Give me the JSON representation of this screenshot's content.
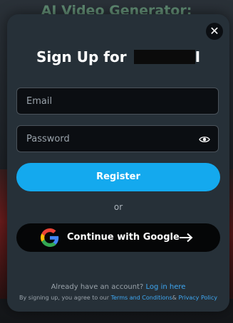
{
  "background": {
    "title": "AI Video Generator:"
  },
  "modal": {
    "close_symbol": "✕",
    "title_prefix": "Sign Up for",
    "title_suffix": "I",
    "email": {
      "placeholder": "Email",
      "value": ""
    },
    "password": {
      "placeholder": "Password",
      "value": "",
      "toggle_icon": "eye-icon"
    },
    "register_label": "Register",
    "divider_text": "or",
    "google": {
      "label": "Continue with Google",
      "icon": "google-icon",
      "arrow_icon": "arrow-right-icon"
    },
    "login_prompt": "Already have an account?",
    "login_link": "Log in here",
    "terms_prefix": "By signing up, you agree to our",
    "terms_link": "Terms and Conditions",
    "terms_joiner": "&",
    "privacy_link": "Privacy Policy"
  },
  "colors": {
    "accent": "#14a9ee",
    "link": "#3fa9f5",
    "modal_bg": "#263038",
    "field_bg": "#0b0e12"
  }
}
